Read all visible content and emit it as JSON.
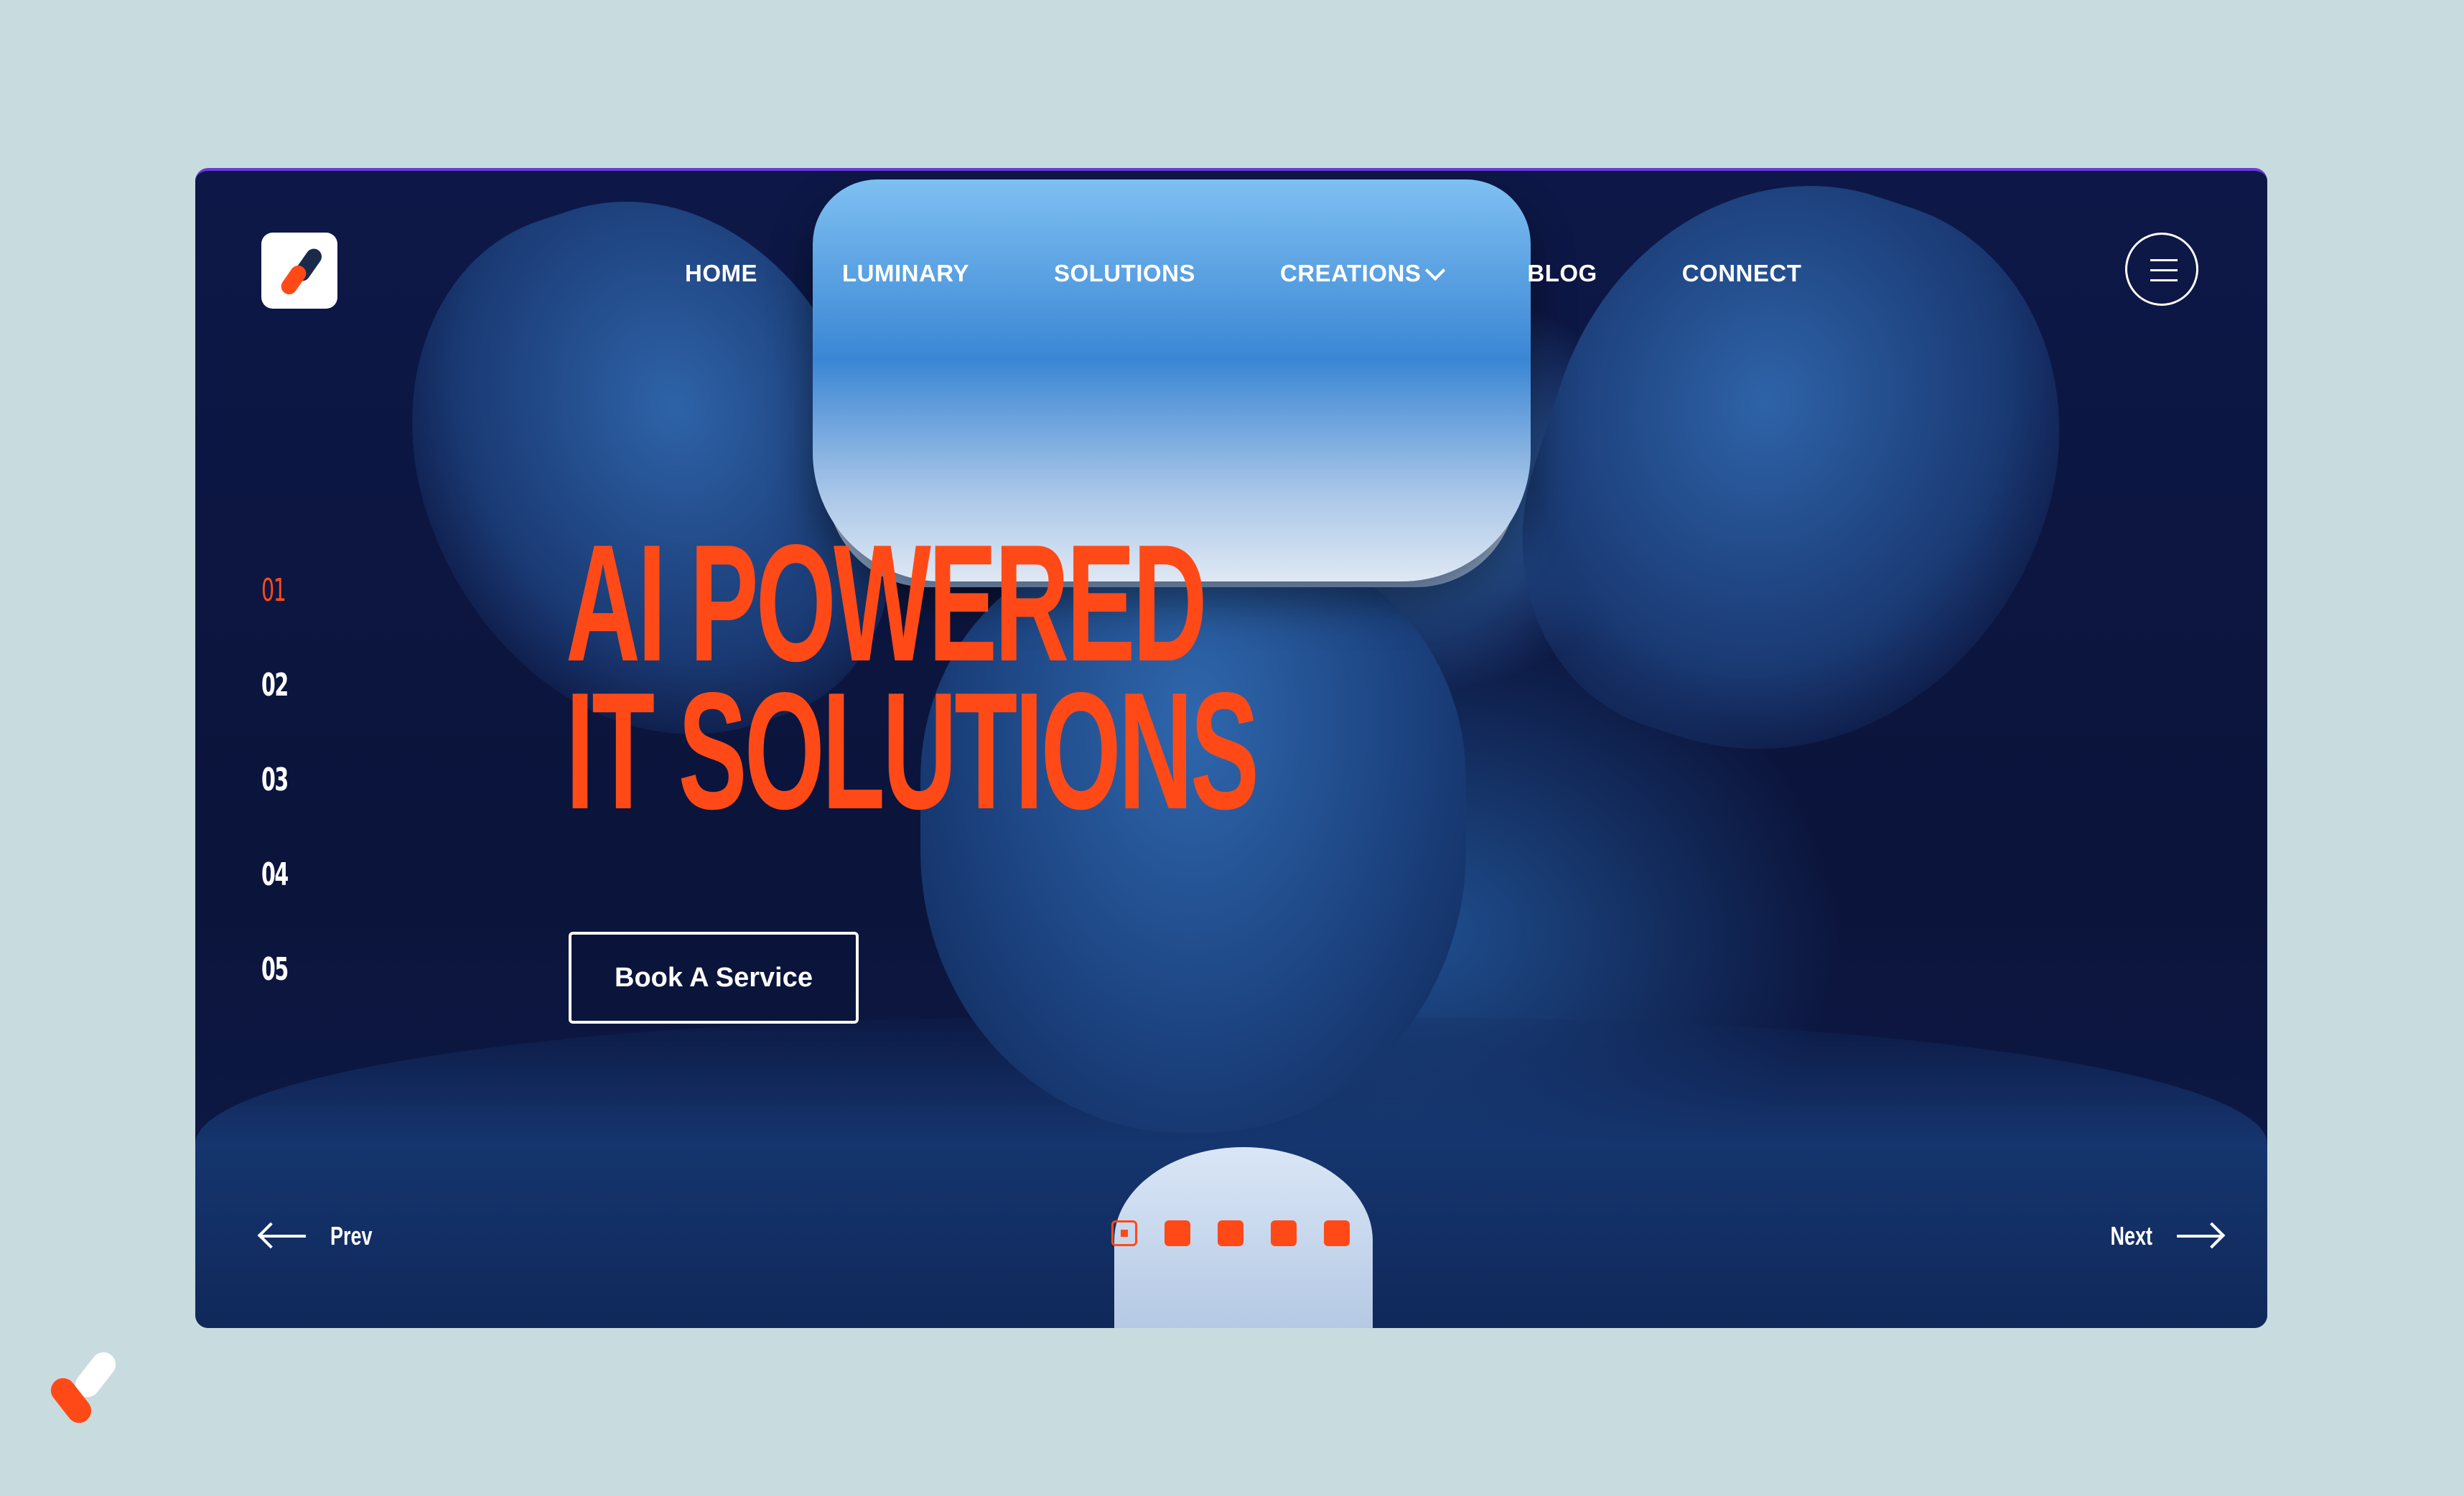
{
  "nav": {
    "items": [
      {
        "label": "HOME"
      },
      {
        "label": "LUMINARY"
      },
      {
        "label": "SOLUTIONS"
      },
      {
        "label": "CREATIONS",
        "has_dropdown": true
      },
      {
        "label": "BLOG"
      },
      {
        "label": "CONNECT"
      }
    ]
  },
  "hero": {
    "headline_line1": "AI POWERED",
    "headline_line2": "IT SOLUTIONS",
    "cta_label": "Book A Service"
  },
  "slides": {
    "numbers": [
      "01",
      "02",
      "03",
      "04",
      "05"
    ],
    "active_index": 0
  },
  "pager": {
    "prev_label": "Prev",
    "next_label": "Next",
    "dot_count": 5,
    "active_dot": 0
  },
  "icons": {
    "logo": "brand-logo-icon",
    "menu": "hamburger-menu-icon",
    "prev": "arrow-left-icon",
    "next": "arrow-right-icon",
    "dropdown": "chevron-down-icon"
  },
  "colors": {
    "accent": "#ff4a18",
    "background": "#c8dbde",
    "hero_dark": "#0d1848",
    "text_light": "#ffffff"
  }
}
